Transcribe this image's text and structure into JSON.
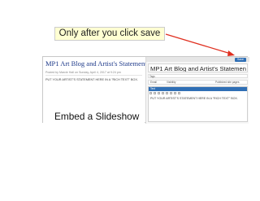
{
  "callout": {
    "text": "Only after you click save"
  },
  "published_post": {
    "title": "MP1 Art Blog and Artist's Statement",
    "meta": "Posted by Marcie Hall on Sunday, April 4, 2017 at 9:24 pm",
    "body": "PUT YOUR ARTIST'S STATEMENT HERE IN A \"RICH TEXT\" BOX."
  },
  "editor_panel": {
    "save_label": "Save",
    "title": "MP1 Art Blog and Artist's Statemen",
    "tags_label": "Tags",
    "toolbar": {
      "email": "Email",
      "visibility": "Visibility",
      "publish": "Published site pages"
    },
    "text_header": "Text",
    "text_body": "PUT YOUR ARTIST'S STATEMENT HERE IN A \"RICH TEXT\" BOX."
  },
  "caption": "Embed a Slideshow",
  "colors": {
    "arrow": "#e03020",
    "accent": "#2f6fb5",
    "title_link": "#1e3a8a",
    "callout_bg": "#ffffd2"
  }
}
